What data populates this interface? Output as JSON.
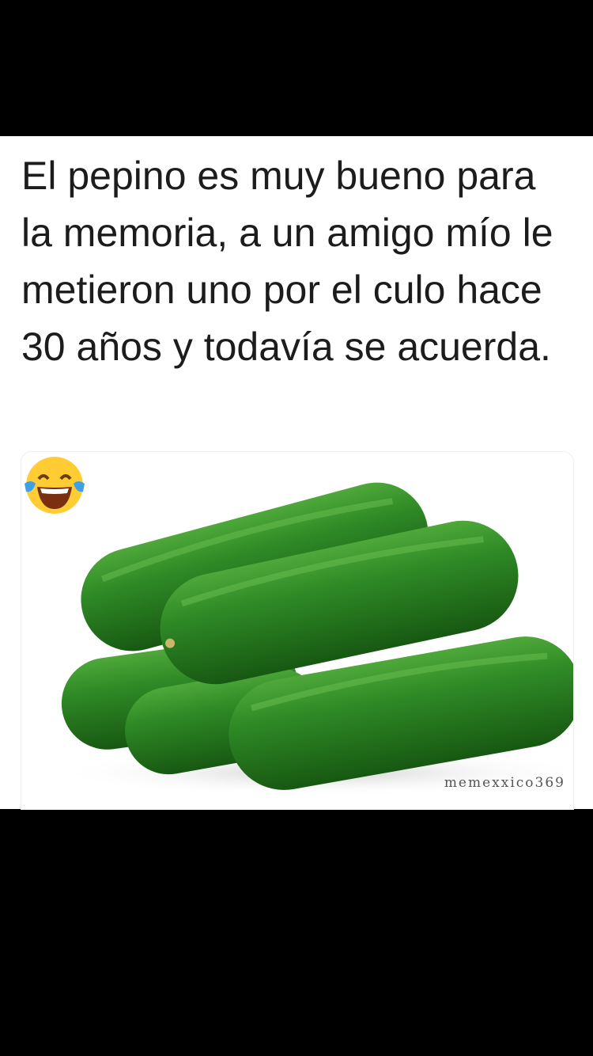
{
  "meme": {
    "caption": "El pepino es muy bueno para la memoria, a un amigo mío le metieron uno por el culo hace 30 años y todavía se acuerda.",
    "image_subject": "cucumbers",
    "emoji": "face-with-tears-of-joy",
    "watermark": "memexxico369"
  },
  "colors": {
    "background": "#000000",
    "card": "#ffffff",
    "text": "#1c1c1c",
    "cucumber": "#2f8a26",
    "cucumber_dark": "#1f6a18",
    "emoji_face": "#ffcc33",
    "tears": "#3fa0e8"
  }
}
